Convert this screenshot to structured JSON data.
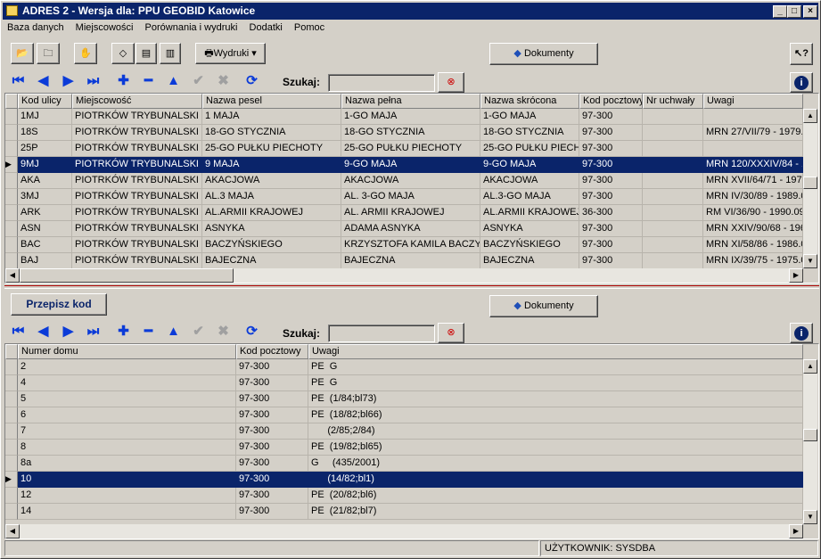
{
  "window": {
    "title": "ADRES 2 - Wersja dla: PPU GEOBID Katowice"
  },
  "menu": [
    "Baza danych",
    "Miejscowości",
    "Porównania i wydruki",
    "Dodatki",
    "Pomoc"
  ],
  "toolbar": {
    "wydruki": "Wydruki",
    "dokumenty": "Dokumenty"
  },
  "search": {
    "label": "Szukaj:",
    "value": ""
  },
  "lower": {
    "przepisz": "Przepisz kod",
    "dokumenty": "Dokumenty",
    "search_label": "Szukaj:"
  },
  "streets": {
    "columns": [
      "Kod ulicy",
      "Miejscowość",
      "Nazwa pesel",
      "Nazwa pełna",
      "Nazwa skrócona",
      "Kod pocztowy",
      "Nr uchwały",
      "Uwagi"
    ],
    "rows": [
      [
        "1MJ",
        "PIOTRKÓW TRYBUNALSKI",
        "1 MAJA",
        "1-GO MAJA",
        "1-GO MAJA",
        "97-300",
        "",
        ""
      ],
      [
        "18S",
        "PIOTRKÓW TRYBUNALSKI",
        "18-GO STYCZNIA",
        "18-GO STYCZNIA",
        "18-GO STYCZNIA",
        "97-300",
        "",
        "MRN 27/VII/79 - 1979."
      ],
      [
        "25P",
        "PIOTRKÓW TRYBUNALSKI",
        "25-GO PUŁKU PIECHOTY",
        "25-GO PUŁKU PIECHOTY",
        "25-GO PUŁKU PIECHI",
        "97-300",
        "",
        ""
      ],
      [
        "9MJ",
        "PIOTRKÓW TRYBUNALSKI",
        "9 MAJA",
        "9-GO MAJA",
        "9-GO MAJA",
        "97-300",
        "",
        "MRN 120/XXXIV/84 - 1"
      ],
      [
        "AKA",
        "PIOTRKÓW TRYBUNALSKI",
        "AKACJOWA",
        "AKACJOWA",
        "AKACJOWA",
        "97-300",
        "",
        "MRN XVII/64/71 - 197"
      ],
      [
        "3MJ",
        "PIOTRKÓW TRYBUNALSKI",
        "AL.3 MAJA",
        "AL. 3-GO MAJA",
        "AL.3-GO MAJA",
        "97-300",
        "",
        "MRN IV/30/89 - 1989.0"
      ],
      [
        "ARK",
        "PIOTRKÓW TRYBUNALSKI",
        "AL.ARMII KRAJOWEJ",
        "AL. ARMII KRAJOWEJ",
        "AL.ARMII KRAJOWEJ",
        "36-300",
        "",
        "RM VI/36/90 - 1990.09"
      ],
      [
        "ASN",
        "PIOTRKÓW TRYBUNALSKI",
        "ASNYKA",
        "ADAMA ASNYKA",
        "ASNYKA",
        "97-300",
        "",
        "MRN XXIV/90/68 - 196"
      ],
      [
        "BAC",
        "PIOTRKÓW TRYBUNALSKI",
        "BACZYŃSKIEGO",
        "KRZYSZTOFA KAMILA BACZYI",
        "BACZYŃSKIEGO",
        "97-300",
        "",
        "MRN XI/58/86 - 1986.0"
      ],
      [
        "BAJ",
        "PIOTRKÓW TRYBUNALSKI",
        "BAJECZNA",
        "BAJECZNA",
        "BAJECZNA",
        "97-300",
        "",
        "MRN IX/39/75 - 1975.0"
      ]
    ],
    "selected": 3
  },
  "houses": {
    "columns": [
      "Numer domu",
      "Kod pocztowy",
      "Uwagi"
    ],
    "rows": [
      [
        "2",
        "97-300",
        "PE  G"
      ],
      [
        "4",
        "97-300",
        "PE  G"
      ],
      [
        "5",
        "97-300",
        "PE  (1/84;bl73)"
      ],
      [
        "6",
        "97-300",
        "PE  (18/82;bl66)"
      ],
      [
        "7",
        "97-300",
        "      (2/85;2/84)"
      ],
      [
        "8",
        "97-300",
        "PE  (19/82;bl65)"
      ],
      [
        "8a",
        "97-300",
        "G     (435/2001)"
      ],
      [
        "10",
        "97-300",
        "      (14/82;bl1)"
      ],
      [
        "12",
        "97-300",
        "PE  (20/82;bl6)"
      ],
      [
        "14",
        "97-300",
        "PE  (21/82;bl7)"
      ]
    ],
    "selected": 7
  },
  "status": {
    "user": "UŻYTKOWNIK: SYSDBA"
  },
  "icons": [
    "mail-icon",
    "folder-open-icon",
    "folder-icon",
    "hand-icon",
    "eraser-icon",
    "copy-icon",
    "paste-icon",
    "printer-icon",
    "book-icon",
    "help-icon",
    "info-icon",
    "search-clear-icon"
  ],
  "colors": {
    "title": "#0a246a",
    "selection": "#0a246a",
    "nav": "#0b3bd8",
    "face": "#d4d0c8"
  }
}
